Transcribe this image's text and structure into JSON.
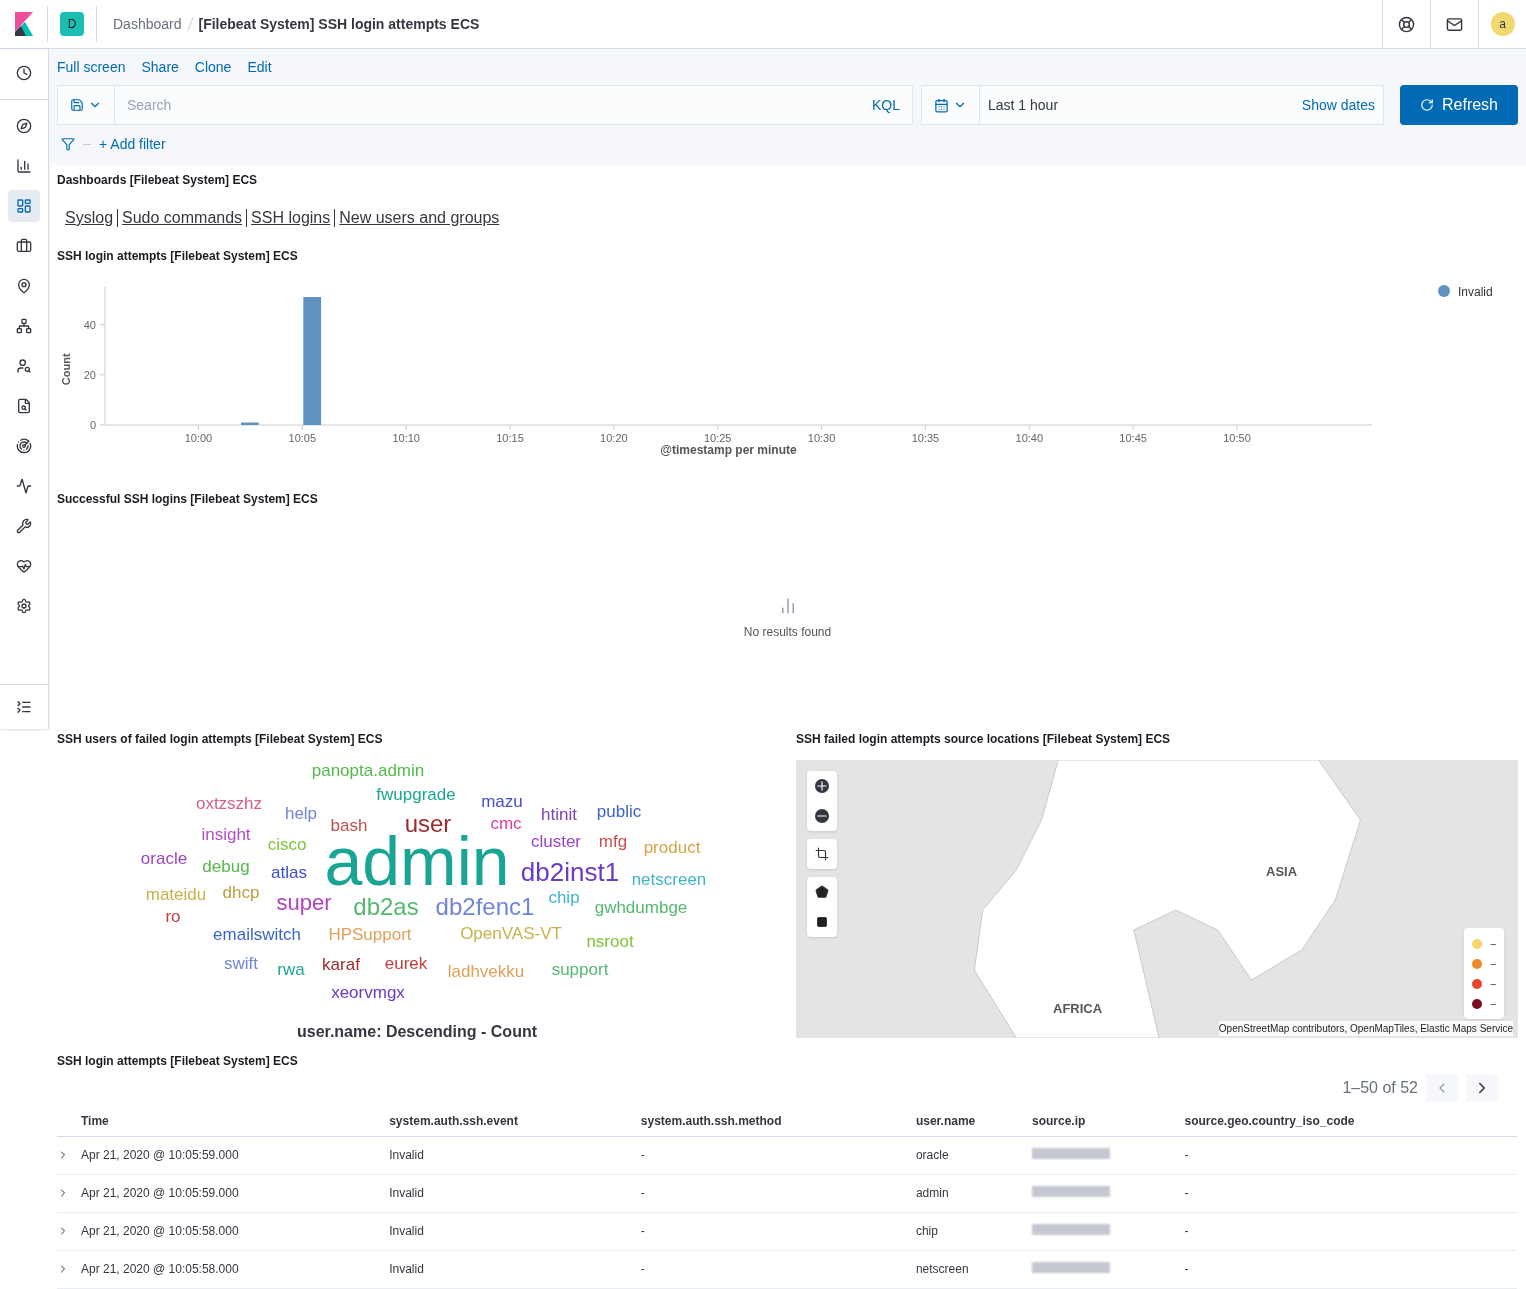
{
  "header": {
    "space_initial": "D",
    "breadcrumbs": [
      "Dashboard",
      "[Filebeat System] SSH login attempts ECS"
    ],
    "avatar_initial": "a"
  },
  "sidebar": {
    "items": [
      {
        "selected": false
      },
      {
        "selected": false
      },
      {
        "selected": false
      },
      {
        "selected": true
      },
      {
        "selected": false
      },
      {
        "selected": false
      },
      {
        "selected": false
      },
      {
        "selected": false
      },
      {
        "selected": false
      },
      {
        "selected": false
      },
      {
        "selected": false
      },
      {
        "selected": false
      },
      {
        "selected": false
      },
      {
        "selected": false
      }
    ]
  },
  "top_nav": [
    "Full screen",
    "Share",
    "Clone",
    "Edit"
  ],
  "query_bar": {
    "placeholder": "Search",
    "language": "KQL",
    "time_range": "Last 1 hour",
    "show_dates": "Show dates",
    "refresh": "Refresh"
  },
  "filter_bar": {
    "add_filter": "+ Add filter"
  },
  "panels": {
    "links": {
      "title": "Dashboards [Filebeat System] ECS",
      "links": [
        "Syslog",
        "Sudo commands",
        "SSH logins",
        "New users and groups"
      ]
    },
    "histogram": {
      "title": "SSH login attempts [Filebeat System] ECS",
      "chart_data": {
        "type": "bar",
        "xlabel": "@timestamp per minute",
        "ylabel": "Count",
        "categories": [
          null,
          null,
          null,
          null,
          "10:00",
          null,
          null,
          null,
          null,
          "10:05",
          null,
          null,
          null,
          null,
          "10:10",
          null,
          null,
          null,
          null,
          "10:15",
          null,
          null,
          null,
          null,
          "10:20",
          null,
          null,
          null,
          null,
          "10:25",
          null,
          null,
          null,
          null,
          "10:30",
          null,
          null,
          null,
          null,
          "10:35",
          null,
          null,
          null,
          null,
          "10:40",
          null,
          null,
          null,
          null,
          "10:45",
          null,
          null,
          null,
          null,
          "10:50",
          null,
          null,
          null,
          null,
          null
        ],
        "series": [
          {
            "name": "Invalid",
            "color": "#6092c0",
            "values": [
              null,
              null,
              null,
              null,
              null,
              null,
              1,
              null,
              null,
              51,
              null,
              null,
              null,
              null,
              null,
              null,
              null,
              null,
              null,
              null,
              null,
              null,
              null,
              null,
              null,
              null,
              null,
              null,
              null,
              null,
              null,
              null,
              null,
              null,
              null,
              null,
              null,
              null,
              null,
              null,
              null,
              null,
              null,
              null,
              null,
              null,
              null,
              null,
              null,
              null,
              null,
              null,
              null,
              null,
              null,
              null,
              null,
              null,
              null,
              null
            ]
          }
        ],
        "ylim": [
          0,
          55
        ],
        "yticks": [
          0,
          20,
          40
        ]
      }
    },
    "successful": {
      "title": "Successful SSH logins [Filebeat System] ECS",
      "empty_message": "No results found"
    },
    "tag_cloud": {
      "title": "SSH users of failed login attempts [Filebeat System] ECS",
      "caption": "user.name: Descending - Count",
      "words": [
        {
          "text": "panopta.admin",
          "color": "#54b849"
        },
        {
          "text": "fwupgrade",
          "color": "#1ea593"
        },
        {
          "text": "oxtzszhz",
          "color": "#d36086"
        },
        {
          "text": "help",
          "color": "#6f86d8"
        },
        {
          "text": "mazu",
          "color": "#4650c3"
        },
        {
          "text": "htinit",
          "color": "#7a3fb5"
        },
        {
          "text": "public",
          "color": "#3d63c4"
        },
        {
          "text": "bash",
          "color": "#c0504d"
        },
        {
          "text": "user",
          "color": "#9c2b2b"
        },
        {
          "text": "cmc",
          "color": "#d33fa0"
        },
        {
          "text": "insight",
          "color": "#b04fc0"
        },
        {
          "text": "cisco",
          "color": "#7fc23a"
        },
        {
          "text": "admin",
          "color": "#18a594"
        },
        {
          "text": "cluster",
          "color": "#9943c7"
        },
        {
          "text": "mfg",
          "color": "#d04a4a"
        },
        {
          "text": "product",
          "color": "#d6a34a"
        },
        {
          "text": "oracle",
          "color": "#9b45c4"
        },
        {
          "text": "debug",
          "color": "#56b84a"
        },
        {
          "text": "atlas",
          "color": "#3f4ec4"
        },
        {
          "text": "db2inst1",
          "color": "#6c3bc4"
        },
        {
          "text": "netscreen",
          "color": "#40b4c8"
        },
        {
          "text": "mateidu",
          "color": "#c9b04a"
        },
        {
          "text": "dhcp",
          "color": "#c09b40"
        },
        {
          "text": "super",
          "color": "#b43fc4"
        },
        {
          "text": "db2as",
          "color": "#54b870"
        },
        {
          "text": "db2fenc1",
          "color": "#6f86d8"
        },
        {
          "text": "chip",
          "color": "#40b4c9"
        },
        {
          "text": "gwhdumbge",
          "color": "#54b871"
        },
        {
          "text": "ro",
          "color": "#c0403f"
        },
        {
          "text": "emailswitch",
          "color": "#3d63c5"
        },
        {
          "text": "HPSupport",
          "color": "#e0a05a"
        },
        {
          "text": "OpenVAS-VT",
          "color": "#c9b04b"
        },
        {
          "text": "nsroot",
          "color": "#7fc23b"
        },
        {
          "text": "swift",
          "color": "#6f86d9"
        },
        {
          "text": "rwa",
          "color": "#1ea595"
        },
        {
          "text": "karaf",
          "color": "#9c2b2c"
        },
        {
          "text": "eurek",
          "color": "#c04040"
        },
        {
          "text": "ladhvekku",
          "color": "#e0a05b"
        },
        {
          "text": "support",
          "color": "#54b872"
        },
        {
          "text": "xeorvmgx",
          "color": "#6c3bc5"
        }
      ]
    },
    "map": {
      "title": "SSH failed login attempts source locations [Filebeat System] ECS",
      "labels": [
        "ASIA",
        "AFRICA"
      ],
      "attribution": "OpenStreetMap contributors, OpenMapTiles, Elastic Maps Service",
      "legend": [
        {
          "color": "#f5d56b",
          "label": "–"
        },
        {
          "color": "#ee8a2c",
          "label": "–"
        },
        {
          "color": "#e6452b",
          "label": "–"
        },
        {
          "color": "#7a0d1d",
          "label": "–"
        }
      ]
    },
    "table": {
      "title": "SSH login attempts [Filebeat System] ECS",
      "pagination": "1–50 of 52",
      "columns": [
        "Time",
        "system.auth.ssh.event",
        "system.auth.ssh.method",
        "user.name",
        "source.ip",
        "source.geo.country_iso_code"
      ],
      "rows": [
        {
          "time": "Apr 21, 2020 @ 10:05:59.000",
          "event": "Invalid",
          "method": "-",
          "user": "oracle",
          "country": "-"
        },
        {
          "time": "Apr 21, 2020 @ 10:05:59.000",
          "event": "Invalid",
          "method": "-",
          "user": "admin",
          "country": "-"
        },
        {
          "time": "Apr 21, 2020 @ 10:05:58.000",
          "event": "Invalid",
          "method": "-",
          "user": "chip",
          "country": "-"
        },
        {
          "time": "Apr 21, 2020 @ 10:05:58.000",
          "event": "Invalid",
          "method": "-",
          "user": "netscreen",
          "country": "-"
        }
      ]
    }
  }
}
